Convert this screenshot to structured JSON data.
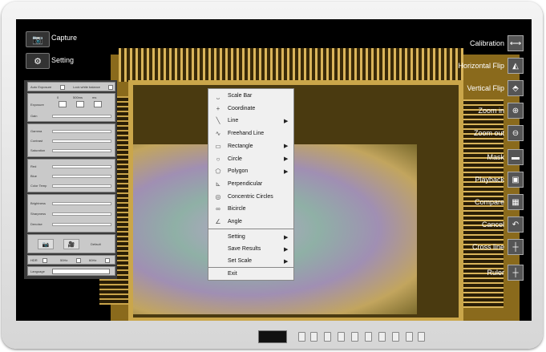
{
  "left_toolbar": {
    "capture_label": "Capture",
    "setting_label": "Setting",
    "auto_exposure": "Auto Exposure",
    "lock_white_balance": "Lock white balance",
    "exposure": "Exposure",
    "exposure_scale": [
      "0",
      "500ms",
      "ms"
    ],
    "gain": "Gain",
    "gamma": "Gamma",
    "contrast": "Contrast",
    "saturation": "Saturation",
    "red": "Red",
    "blue": "Blue",
    "color_temp": "Color Temp",
    "brightness": "Brightness",
    "sharpness": "Sharpness",
    "denoise": "Denoise",
    "default": "Default",
    "hdr": "HDR",
    "hz50": "50Hz",
    "hz60": "60Hz",
    "language": "Language"
  },
  "right_toolbar": [
    {
      "label": "Calibration",
      "icon": "calibration-icon",
      "glyph": "⟷"
    },
    {
      "label": "Horizontal Flip",
      "icon": "horizontal-flip-icon",
      "glyph": "◭"
    },
    {
      "label": "Vertical Flip",
      "icon": "vertical-flip-icon",
      "glyph": "⬘"
    },
    {
      "label": "Zoom in",
      "icon": "zoom-in-icon",
      "glyph": "⊕"
    },
    {
      "label": "Zoom out",
      "icon": "zoom-out-icon",
      "glyph": "⊖"
    },
    {
      "label": "Mask",
      "icon": "mask-icon",
      "glyph": "▬"
    },
    {
      "label": "Playback",
      "icon": "playback-icon",
      "glyph": "▣"
    },
    {
      "label": "Compare",
      "icon": "compare-icon",
      "glyph": "▦"
    },
    {
      "label": "Cancel",
      "icon": "cancel-icon",
      "glyph": "↶"
    },
    {
      "label": "Cross line",
      "icon": "cross-line-icon",
      "glyph": "┼"
    },
    {
      "label": "Ruler",
      "icon": "ruler-icon",
      "glyph": "┼"
    }
  ],
  "context_menu": {
    "tools": [
      {
        "label": "Scale Bar",
        "glyph": "⎵",
        "submenu": false
      },
      {
        "label": "Coordinate",
        "glyph": "+",
        "submenu": false
      },
      {
        "label": "Line",
        "glyph": "╲",
        "submenu": true
      },
      {
        "label": "Freehand Line",
        "glyph": "∿",
        "submenu": false
      },
      {
        "label": "Rectangle",
        "glyph": "▭",
        "submenu": true
      },
      {
        "label": "Circle",
        "glyph": "○",
        "submenu": true
      },
      {
        "label": "Polygon",
        "glyph": "⬠",
        "submenu": true
      },
      {
        "label": "Perpendicular",
        "glyph": "⊾",
        "submenu": false
      },
      {
        "label": "Concentric Circles",
        "glyph": "◎",
        "submenu": false
      },
      {
        "label": "Bicircle",
        "glyph": "∞",
        "submenu": false
      },
      {
        "label": "Angle",
        "glyph": "∠",
        "submenu": false
      }
    ],
    "actions": [
      {
        "label": "Setting",
        "submenu": true
      },
      {
        "label": "Save Results",
        "submenu": true
      },
      {
        "label": "Set Scale",
        "submenu": true
      }
    ],
    "exit": "Exit"
  },
  "bezel_buttons": [
    "",
    "",
    "",
    "",
    "",
    "",
    "",
    "",
    "",
    ""
  ]
}
